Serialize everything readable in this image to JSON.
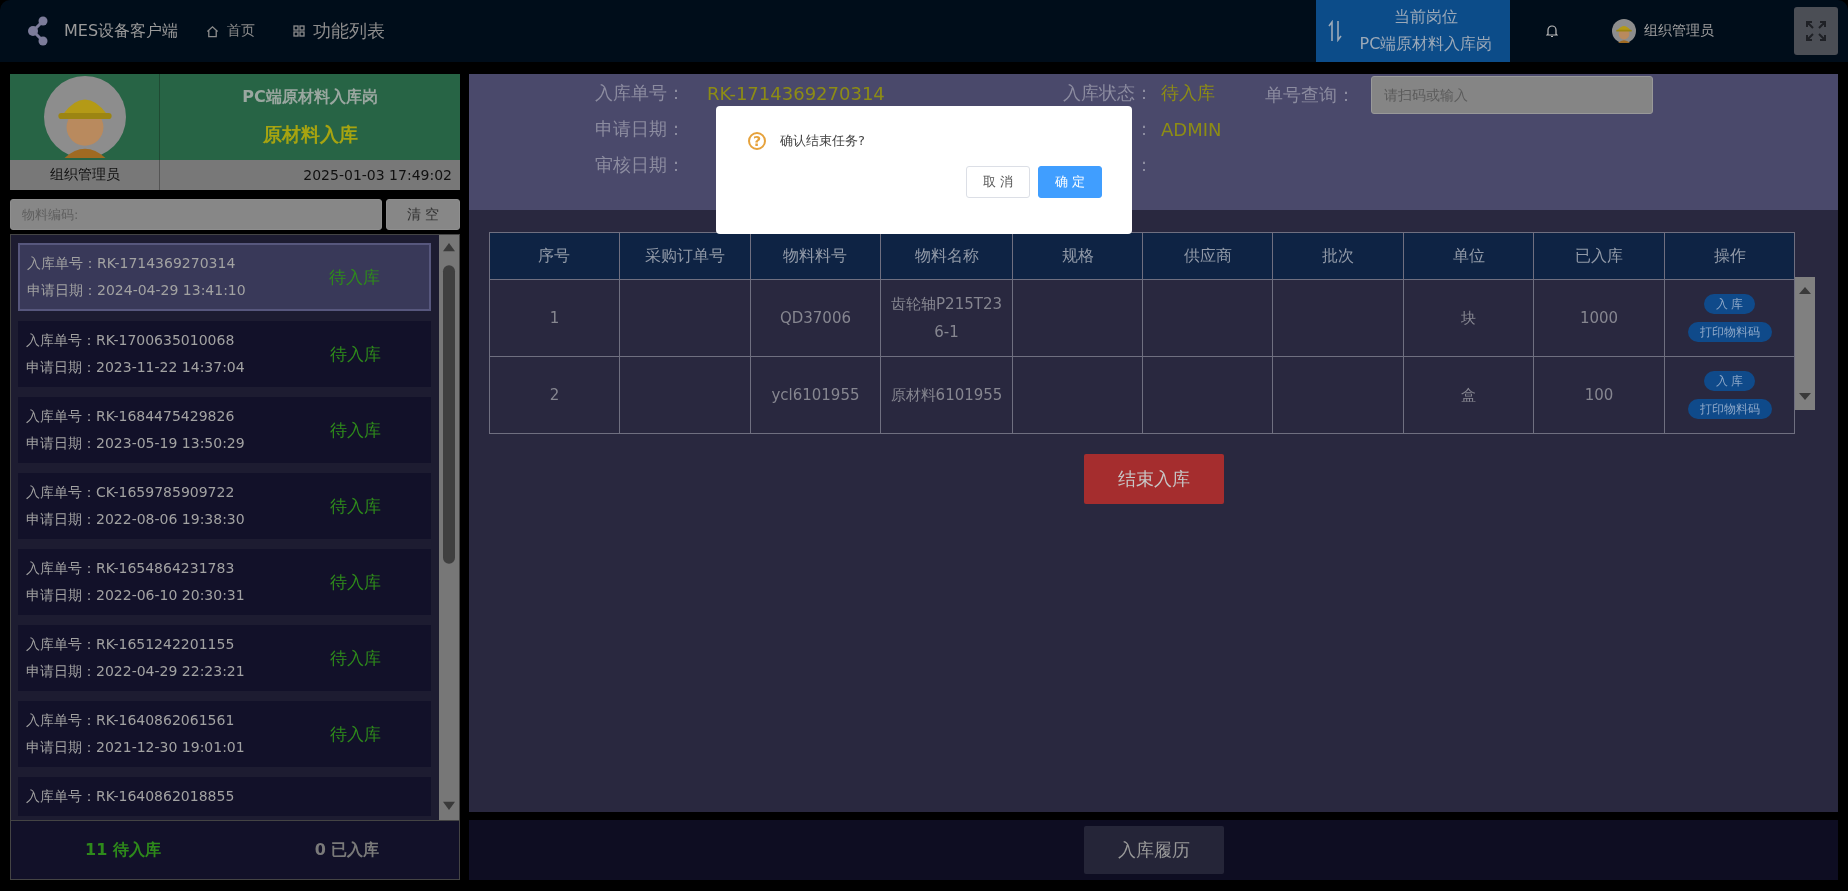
{
  "app": {
    "title": "MES设备客户端"
  },
  "nav": [
    {
      "kind": "home",
      "label": "首页"
    },
    {
      "kind": "grid",
      "label": "功能列表"
    }
  ],
  "post": {
    "label": "当前岗位",
    "value": "PC端原材料入库岗"
  },
  "user": {
    "name": "组织管理员"
  },
  "profile": {
    "post": "PC端原材料入库岗",
    "task": "原材料入库",
    "user": "组织管理员",
    "time": "2025-01-03 17:49:02"
  },
  "filter": {
    "placeholder": "物料编码:",
    "button": "清 空"
  },
  "orders": [
    {
      "number_label": "入库单号：",
      "number": "RK-1714369270314",
      "date_label": "申请日期：",
      "date": "2024-04-29 13:41:10",
      "status": "待入库",
      "selected": true
    },
    {
      "number_label": "入库单号：",
      "number": "RK-1700635010068",
      "date_label": "申请日期：",
      "date": "2023-11-22 14:37:04",
      "status": "待入库",
      "selected": false
    },
    {
      "number_label": "入库单号：",
      "number": "RK-1684475429826",
      "date_label": "申请日期：",
      "date": "2023-05-19 13:50:29",
      "status": "待入库",
      "selected": false
    },
    {
      "number_label": "入库单号：",
      "number": "CK-1659785909722",
      "date_label": "申请日期：",
      "date": "2022-08-06 19:38:30",
      "status": "待入库",
      "selected": false
    },
    {
      "number_label": "入库单号：",
      "number": "RK-1654864231783",
      "date_label": "申请日期：",
      "date": "2022-06-10 20:30:31",
      "status": "待入库",
      "selected": false
    },
    {
      "number_label": "入库单号：",
      "number": "RK-1651242201155",
      "date_label": "申请日期：",
      "date": "2022-04-29 22:23:21",
      "status": "待入库",
      "selected": false
    },
    {
      "number_label": "入库单号：",
      "number": "RK-1640862061561",
      "date_label": "申请日期：",
      "date": "2021-12-30 19:01:01",
      "status": "待入库",
      "selected": false
    },
    {
      "number_label": "入库单号：",
      "number": "RK-1640862018855",
      "selected": false
    }
  ],
  "summary": [
    {
      "kind": "pending",
      "text": "11 待入库"
    },
    {
      "kind": "done",
      "text": "0 已入库"
    }
  ],
  "details": {
    "columns": [
      [
        {
          "label": "入库单号：",
          "value": "RK-1714369270314"
        },
        {
          "label": "申请日期："
        },
        {
          "label": "审核日期："
        }
      ],
      [
        {
          "label": "入库状态：",
          "value": "待入库"
        },
        {
          "label": "：",
          "value": "ADMIN"
        },
        {
          "label": "："
        }
      ],
      [
        {
          "label": "单号查询：",
          "placeholder": "请扫码或输入"
        }
      ]
    ]
  },
  "table": {
    "columns": [
      "序号",
      "采购订单号",
      "物料料号",
      "物料名称",
      "规格",
      "供应商",
      "批次",
      "单位",
      "已入库",
      "操作"
    ],
    "rows": [
      {
        "index": "1",
        "material_code": "QD37006",
        "material_name": "齿轮轴P215T236-1",
        "unit": "块",
        "received": "1000",
        "actions": [
          "入 库",
          "打印物料码"
        ]
      },
      {
        "index": "2",
        "material_code": "ycl6101955",
        "material_name": "原材料6101955",
        "unit": "盒",
        "received": "100",
        "actions": [
          "入 库",
          "打印物料码"
        ]
      }
    ]
  },
  "finish_button": "结束入库",
  "history_button": "入库履历",
  "dialog": {
    "icon": "?",
    "message": "确认结束任务?",
    "buttons": [
      {
        "kind": "default",
        "label": "取 消"
      },
      {
        "kind": "primary",
        "label": "确 定"
      }
    ]
  }
}
